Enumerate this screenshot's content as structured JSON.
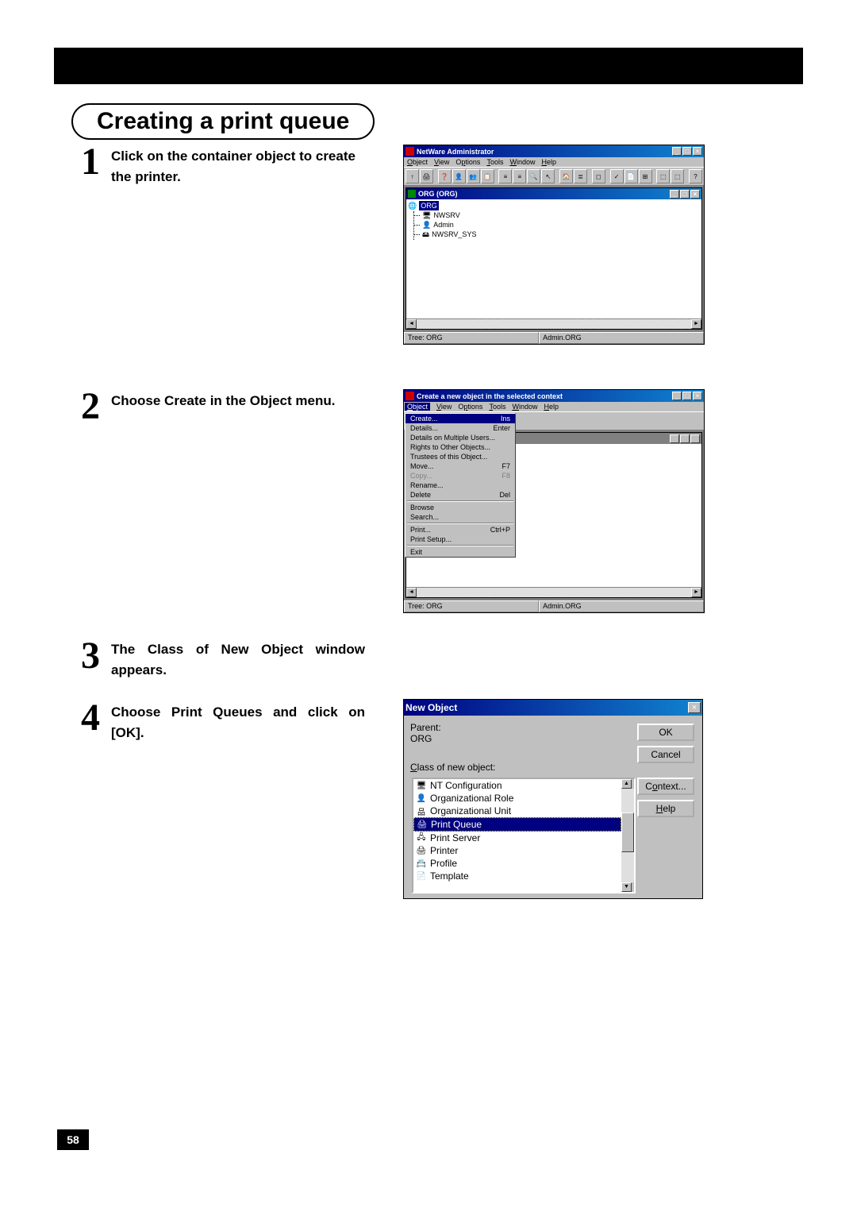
{
  "page_number": "58",
  "heading": "Creating a print queue",
  "steps": {
    "s1_num": "1",
    "s1_text": "Click on the container object to create the printer.",
    "s2_num": "2",
    "s2_text": "Choose Create in the Object menu.",
    "s3_num": "3",
    "s3_text": "The Class of New Object window appears.",
    "s4_num": "4",
    "s4_text": "Choose Print Queues and click on [OK]."
  },
  "shot1": {
    "title": "NetWare Administrator",
    "menu": {
      "object": "Object",
      "view": "View",
      "options": "Options",
      "tools": "Tools",
      "window": "Window",
      "help": "Help"
    },
    "mdi_title": "ORG (ORG)",
    "tree": {
      "root": "ORG",
      "n1": "NWSRV",
      "n2": "Admin",
      "n3": "NWSRV_SYS"
    },
    "status_left": "Tree: ORG",
    "status_right": "Admin.ORG"
  },
  "shot2": {
    "title": "Create a new object in the selected context",
    "menu_items": [
      {
        "label": "Create...",
        "shortcut": "Ins",
        "hl": true
      },
      {
        "label": "Details...",
        "shortcut": "Enter"
      },
      {
        "label": "Details on Multiple Users..."
      },
      {
        "label": "Rights to Other Objects..."
      },
      {
        "label": "Trustees of this Object..."
      },
      {
        "label": "Move...",
        "shortcut": "F7"
      },
      {
        "label": "Copy...",
        "shortcut": "F8",
        "disabled": true
      },
      {
        "label": "Rename..."
      },
      {
        "label": "Delete",
        "shortcut": "Del"
      },
      {
        "sep": true
      },
      {
        "label": "Browse"
      },
      {
        "label": "Search..."
      },
      {
        "sep": true
      },
      {
        "label": "Print...",
        "shortcut": "Ctrl+P"
      },
      {
        "label": "Print Setup..."
      },
      {
        "sep": true
      },
      {
        "label": "Exit"
      }
    ],
    "status_left": "Tree: ORG",
    "status_right": "Admin.ORG"
  },
  "shot3": {
    "title": "New Object",
    "parent_label": "Parent:",
    "parent_value": "ORG",
    "class_label": "Class of new object:",
    "buttons": {
      "ok": "OK",
      "cancel": "Cancel",
      "context": "Context...",
      "help": "Help"
    },
    "items": [
      {
        "label": "NT Configuration"
      },
      {
        "label": "Organizational Role"
      },
      {
        "label": "Organizational Unit"
      },
      {
        "label": "Print Queue",
        "sel": true
      },
      {
        "label": "Print Server"
      },
      {
        "label": "Printer"
      },
      {
        "label": "Profile"
      },
      {
        "label": "Template"
      }
    ]
  }
}
